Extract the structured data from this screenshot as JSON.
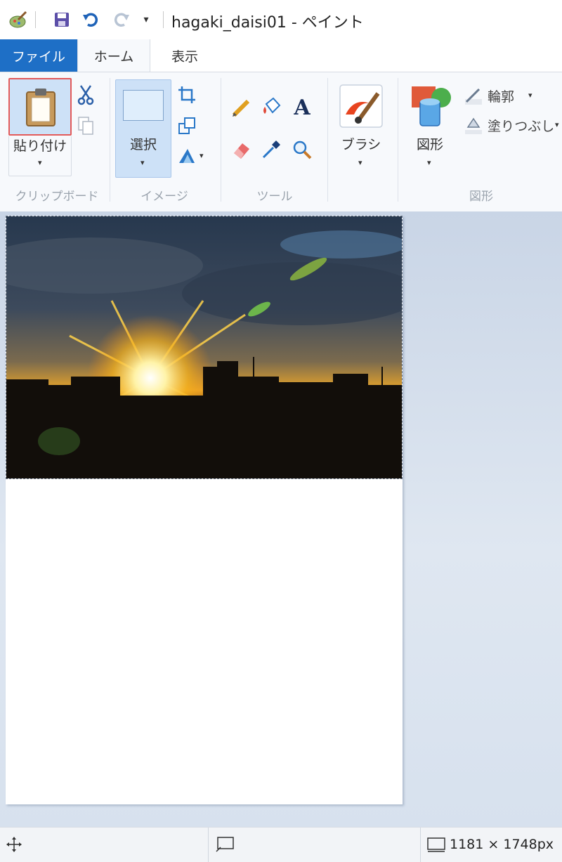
{
  "titlebar": {
    "title": "hagaki_daisi01 - ペイント",
    "qat_dropdown": "▾"
  },
  "tabs": {
    "file": "ファイル",
    "home": "ホーム",
    "view": "表示"
  },
  "ribbon": {
    "clipboard": {
      "group_label": "クリップボード",
      "paste_label": "貼り付け",
      "arrow": "▾"
    },
    "image": {
      "group_label": "イメージ",
      "select_label": "選択",
      "arrow": "▾",
      "rotate_arrow": "▾"
    },
    "tools": {
      "group_label": "ツール"
    },
    "brushes": {
      "label": "ブラシ",
      "arrow": "▾"
    },
    "shapes": {
      "group_label": "図形",
      "shapes_label": "図形",
      "arrow": "▾",
      "outline_label": "輪郭",
      "outline_arrow": "▾",
      "fill_label": "塗りつぶし",
      "fill_arrow": "▾"
    }
  },
  "statusbar": {
    "image_size": "1181 × 1748px"
  },
  "colors": {
    "file_tab": "#1e6fc6",
    "selected_button": "#cde1f7",
    "paste_highlight": "#e35a5a"
  }
}
